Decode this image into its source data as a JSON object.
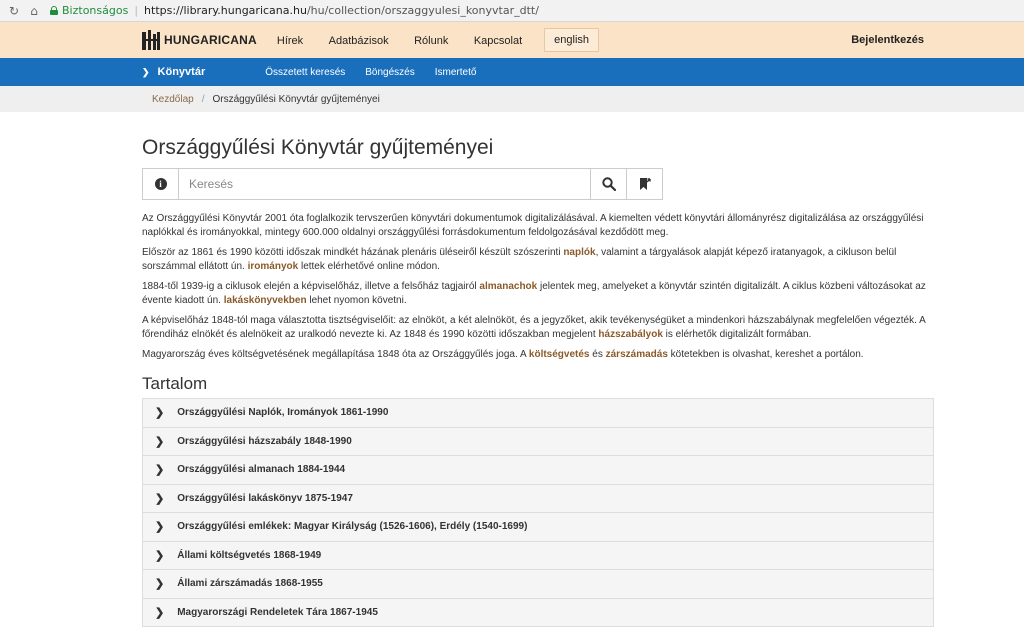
{
  "browser": {
    "secure_label": "Biztonságos",
    "url_host": "https://library.hungaricana.hu",
    "url_path": "/hu/collection/orszaggyulesi_konyvtar_dtt/"
  },
  "header": {
    "logo_text": "HUNGARICANA",
    "nav": [
      "Hírek",
      "Adatbázisok",
      "Rólunk",
      "Kapcsolat"
    ],
    "language_button": "english",
    "login": "Bejelentkezés"
  },
  "subnav": {
    "section": "Könyvtár",
    "items": [
      "Összetett keresés",
      "Böngészés",
      "Ismertető"
    ]
  },
  "breadcrumb": {
    "home": "Kezdőlap",
    "current": "Országgyűlési Könyvtár gyűjteményei"
  },
  "page": {
    "title": "Országgyűlési Könyvtár gyűjteményei",
    "search_placeholder": "Keresés",
    "paragraphs": [
      "Az Országgyűlési Könyvtár 2001 óta foglalkozik tervszerűen könyvtári dokumentumok digitalizálásával. A kiemelten védett könyvtári állományrész digitalizálása az országgyűlési naplókkal és irományokkal, mintegy 600.000 oldalnyi országgyűlési forrásdokumentum feldolgozásával kezdődött meg.",
      "Először az 1861 és 1990 közötti időszak mindkét házának plenáris üléseiről készült szószerinti <b>naplók</b>, valamint a tárgyalások alapját képező iratanyagok, a cikluson belül sorszámmal ellátott ún. <b>irományok</b> lettek elérhetővé online módon.",
      "1884-től 1939-ig a ciklusok elején a képviselőház, illetve a felsőház tagjairól <b>almanachok</b> jelentek meg, amelyeket a könyvtár szintén digitalizált. A ciklus közbeni változásokat az évente kiadott ún. <b>lakáskönyvekben</b> lehet nyomon követni.",
      "A képviselőház 1848-tól maga választotta tisztségviselőit: az elnököt, a két alelnököt, és a jegyzőket, akik tevékenységüket a mindenkori házszabálynak megfelelően végezték. A főrendiház elnökét és alelnökeit az uralkodó nevezte ki. Az 1848 és 1990 közötti időszakban megjelent <b>házszabályok</b> is elérhetők digitalizált formában.",
      "Magyarország éves költségvetésének megállapítása 1848 óta az Országgyűlés joga. A <b>költségvetés</b> és <b>zárszámadás</b> kötetekben is olvashat, kereshet a portálon."
    ],
    "contents_heading": "Tartalom",
    "contents": [
      "Országgyűlési Naplók, Irományok 1861-1990",
      "Országgyűlési házszabály 1848-1990",
      "Országgyűlési almanach 1884-1944",
      "Országgyűlési lakáskönyv 1875-1947",
      "Országgyűlési emlékek: Magyar Királyság (1526-1606), Erdély (1540-1699)",
      "Állami költségvetés 1868-1949",
      "Állami zárszámadás 1868-1955",
      "Magyarországi Rendeletek Tára 1867-1945"
    ]
  },
  "icons": {
    "back": "back-arrow-icon",
    "reload": "reload-icon",
    "home": "home-icon",
    "info": "info-icon",
    "search": "search-icon",
    "bookmark": "bookmark-icon",
    "expand": "chevron-right-icon"
  },
  "colors": {
    "header_bg": "#fbe3c7",
    "subnav_bg": "#1a6fbd",
    "link_brown": "#8a5a2a"
  }
}
